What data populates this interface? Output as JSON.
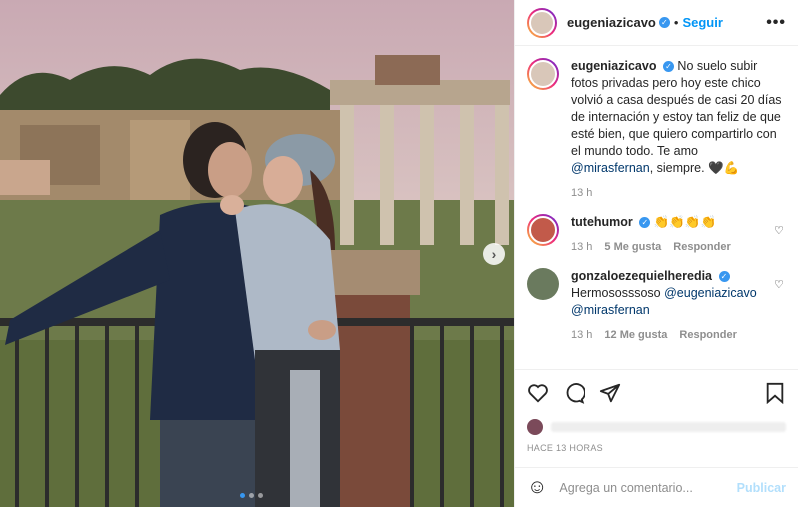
{
  "header": {
    "username": "eugeniazicavo",
    "separator": "•",
    "follow_label": "Seguir",
    "more_label": "•••"
  },
  "caption": {
    "username": "eugeniazicavo",
    "text": "No suelo subir fotos privadas pero hoy este chico volvió a casa después de casi 20 días de internación y estoy tan feliz de que esté bien, que quiero compartirlo con el mundo todo. Te amo",
    "mention": "@mirasfernan",
    "text_end": ", siempre. 🖤💪",
    "time": "13 h"
  },
  "comments": [
    {
      "username": "tutehumor",
      "text": "👏👏👏👏",
      "time": "13 h",
      "likes": "5 Me gusta",
      "reply_label": "Responder"
    },
    {
      "username": "gonzaloezequielheredia",
      "text": "Hermososssoso",
      "mentions": "@eugeniazicavo @mirasfernan",
      "time": "13 h",
      "likes": "12 Me gusta",
      "reply_label": "Responder"
    }
  ],
  "post_time": "HACE 13 HORAS",
  "comment_box": {
    "placeholder": "Agrega un comentario...",
    "publish_label": "Publicar"
  },
  "carousel": {
    "count": 3,
    "active": 0
  },
  "icons": [
    "heart-icon",
    "comment-icon",
    "share-icon",
    "bookmark-icon",
    "emoji-icon",
    "next-icon",
    "verified-icon"
  ],
  "colors": {
    "accent": "#0095f6",
    "verified": "#3897f0",
    "muted": "#8e8e8e"
  }
}
